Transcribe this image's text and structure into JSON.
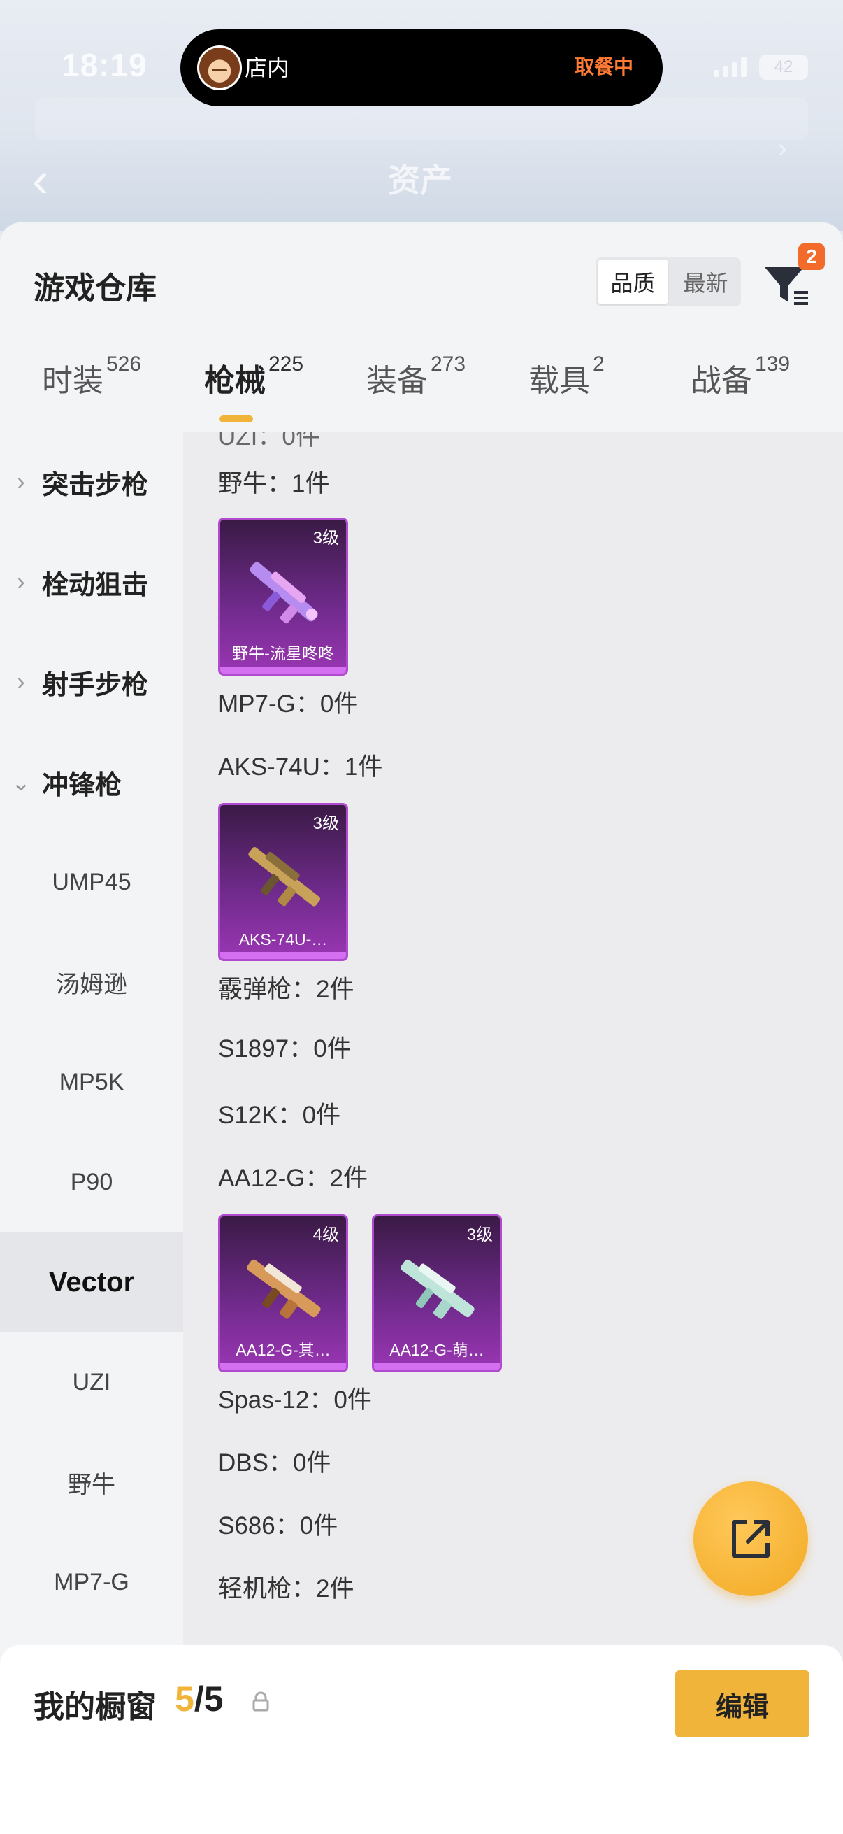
{
  "status_bar": {
    "time": "18:19",
    "battery": "42"
  },
  "island": {
    "store": "店内",
    "status": "取餐中"
  },
  "header": {
    "title": "资产"
  },
  "sheet": {
    "title": "游戏仓库",
    "sort": {
      "quality": "品质",
      "newest": "最新"
    },
    "filter_badge": "2"
  },
  "tabs": [
    {
      "label": "时装",
      "count": "526"
    },
    {
      "label": "枪械",
      "count": "225"
    },
    {
      "label": "装备",
      "count": "273"
    },
    {
      "label": "载具",
      "count": "2"
    },
    {
      "label": "战备",
      "count": "139"
    }
  ],
  "sidebar": {
    "groups": [
      "突击步枪",
      "栓动狙击",
      "射手步枪",
      "冲锋枪"
    ],
    "subs": [
      "UMP45",
      "汤姆逊",
      "MP5K",
      "P90",
      "Vector",
      "UZI",
      "野牛",
      "MP7-G"
    ]
  },
  "content": {
    "rows": [
      "野牛：1件",
      "MP7-G：0件",
      "AKS-74U：1件",
      "霰弹枪：2件",
      "S1897：0件",
      "S12K：0件",
      "AA12-G：2件",
      "Spas-12：0件",
      "DBS：0件",
      "S686：0件",
      "轻机枪：2件"
    ],
    "cards": [
      {
        "level": "3级",
        "name": "野牛-流星咚咚"
      },
      {
        "level": "3级",
        "name": "AKS-74U-…"
      },
      {
        "level": "4级",
        "name": "AA12-G-其…"
      },
      {
        "level": "3级",
        "name": "AA12-G-萌…"
      }
    ]
  },
  "bottom": {
    "title": "我的橱窗",
    "count_used": "5",
    "count_total": "/5",
    "edit": "编辑"
  }
}
